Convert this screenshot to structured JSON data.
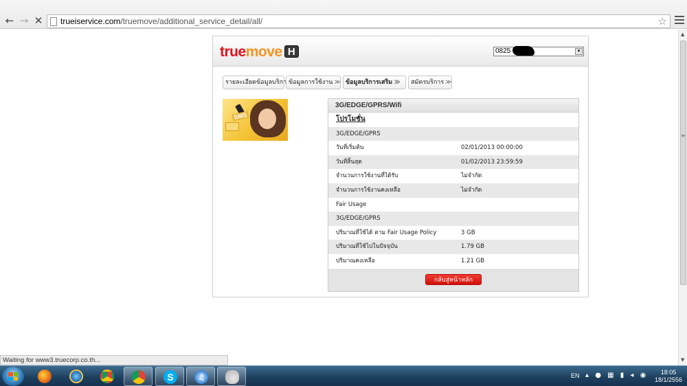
{
  "browser": {
    "url_host": "trueiservice.com",
    "url_path": "/truemove/additional_service_detail/all/",
    "status_text": "Waiting for www3.truecorp.co.th..."
  },
  "header": {
    "logo_true": "true",
    "logo_move": "move",
    "logo_badge": "H",
    "number_prefix": "0825"
  },
  "tabs": [
    {
      "label": "รายละเอียดข้อมูลบริการ"
    },
    {
      "label": "ข้อมูลการใช้งาน"
    },
    {
      "label": "ข้อมูลบริการเสริม"
    },
    {
      "label": "สมัครบริการ"
    }
  ],
  "promo": {
    "sms_label": "SMS"
  },
  "detail": {
    "title": "3G/EDGE/GPRS/Wifi",
    "rows": [
      {
        "k": "โปรโมชั่น",
        "v": ""
      },
      {
        "k": "3G/EDGE/GPRS",
        "v": ""
      },
      {
        "k": "วันที่เริ่มต้น",
        "v": "02/01/2013 00:00:00"
      },
      {
        "k": "วันที่สิ้นสุด",
        "v": "01/02/2013 23:59:59"
      },
      {
        "k": "จำนวนการใช้งานที่ได้รับ",
        "v": "ไม่จำกัด"
      },
      {
        "k": "จำนวนการใช้งานคงเหลือ",
        "v": "ไม่จำกัด"
      },
      {
        "k": "Fair Usage",
        "v": ""
      },
      {
        "k": "3G/EDGE/GPRS",
        "v": ""
      },
      {
        "k": "ปริมาณที่ใช้ได้ ตาม Fair Usage Policy",
        "v": "3 GB"
      },
      {
        "k": "ปริมาณที่ใช้ไปในปัจจุบัน",
        "v": "1.79 GB"
      },
      {
        "k": "ปริมาณคงเหลือ",
        "v": "1.21 GB"
      }
    ],
    "back_button": "กลับสู่หน้าหลัก"
  },
  "taskbar": {
    "language": "EN",
    "time": "18:05",
    "date": "18/1/2556"
  },
  "colors": {
    "brand_red": "#e3101b",
    "brand_orange": "#f7931e",
    "button_red": "#d0100c"
  }
}
